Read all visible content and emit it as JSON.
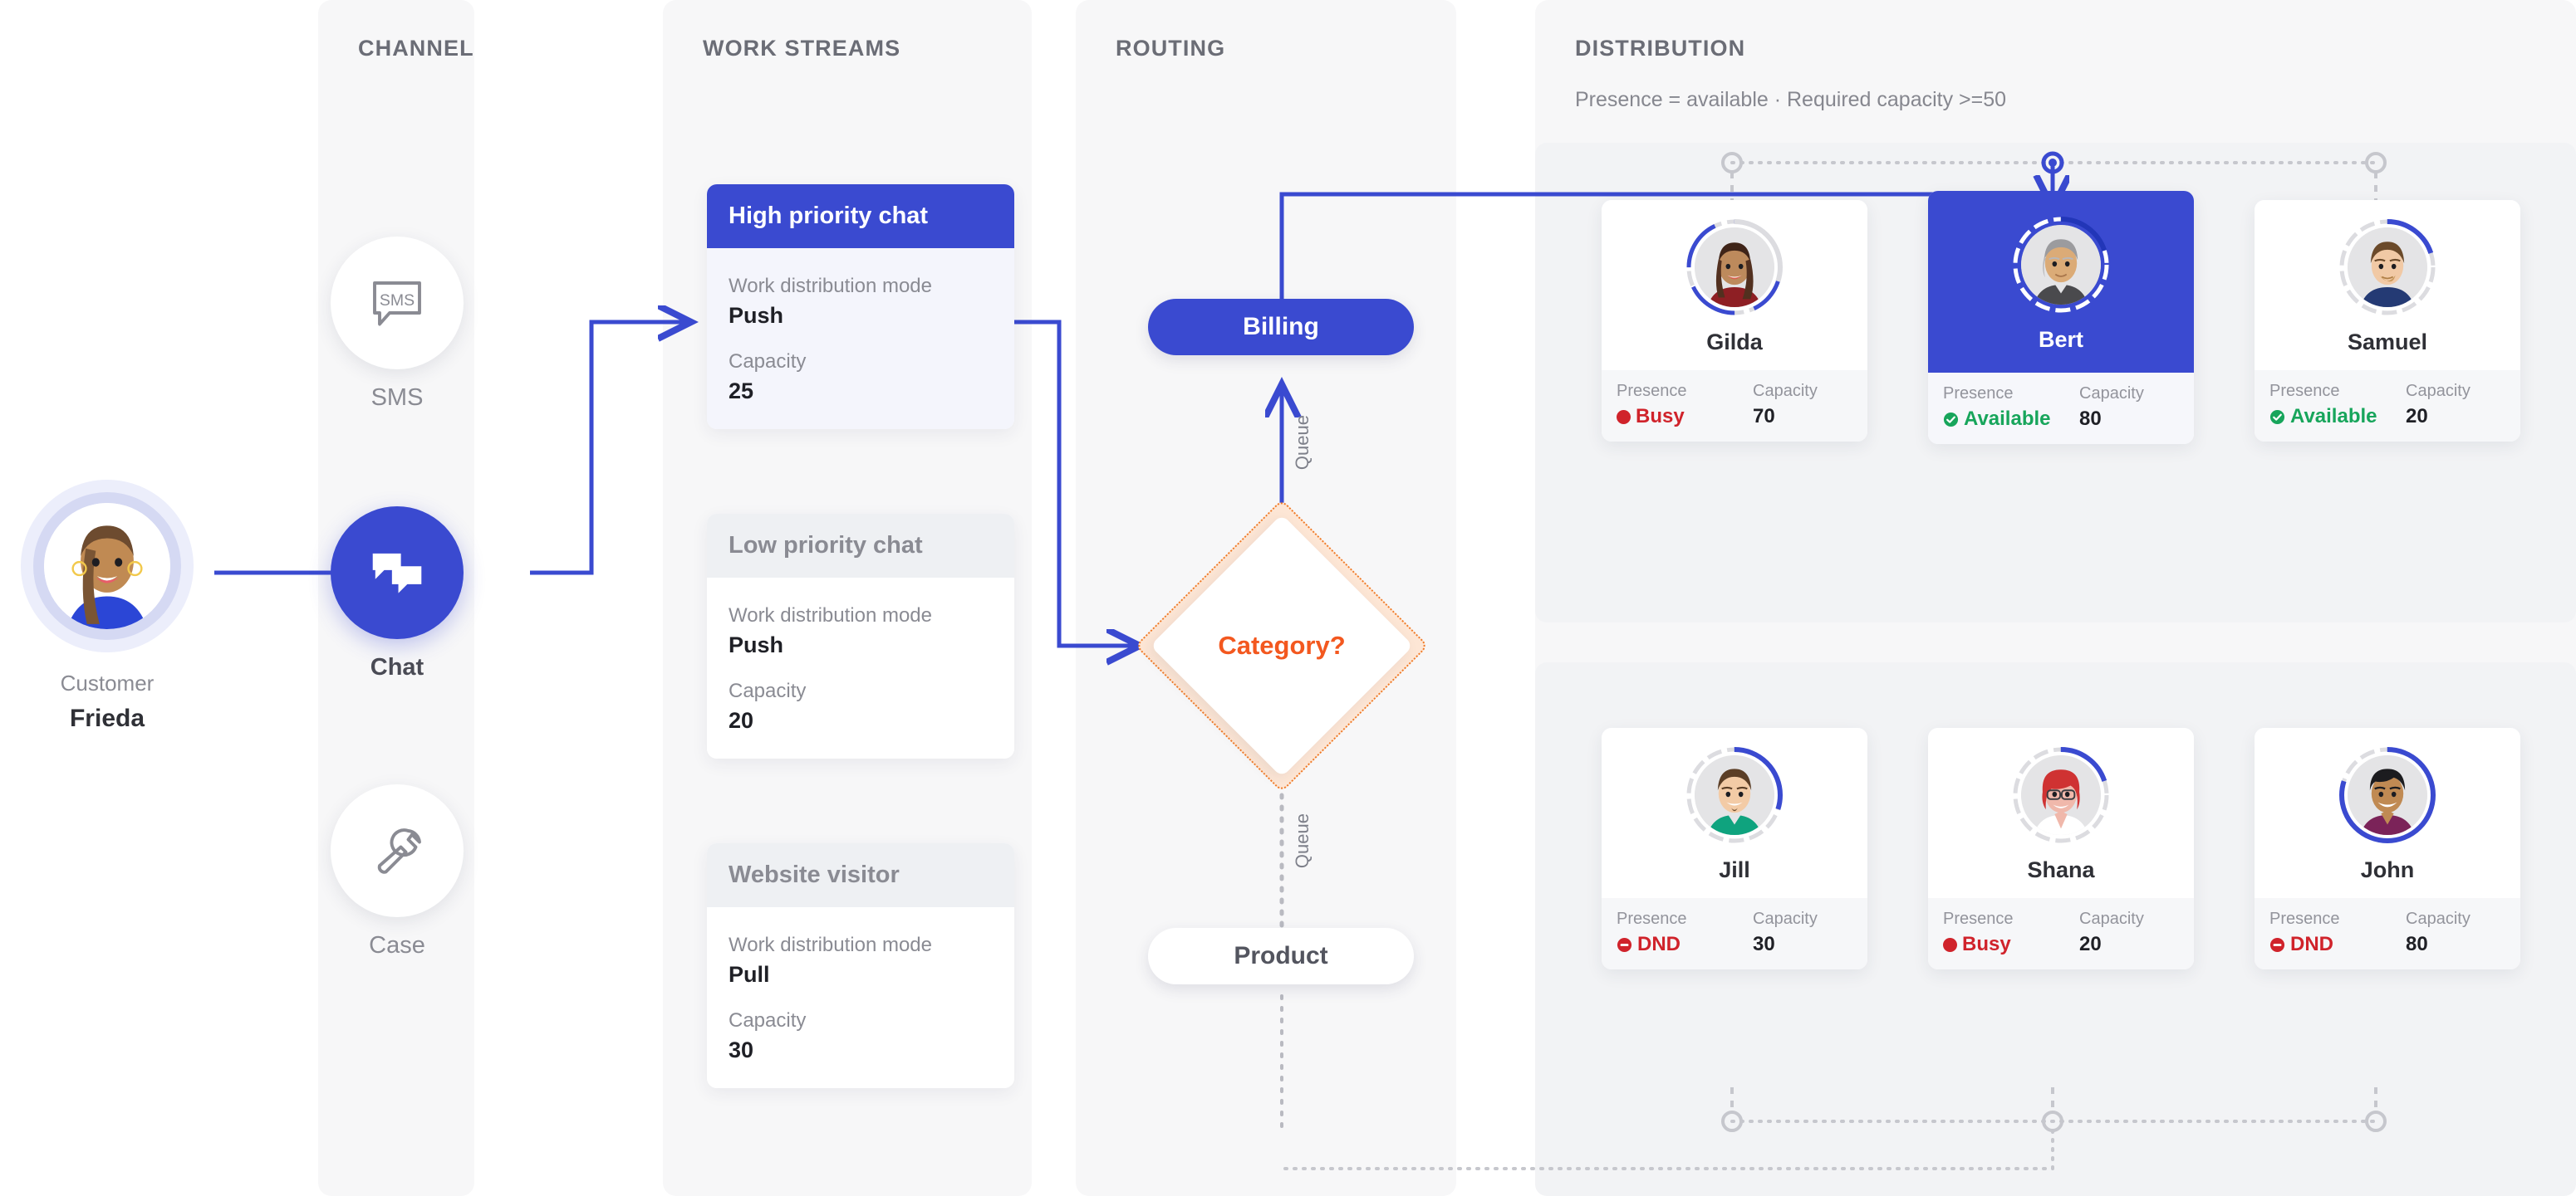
{
  "columns": {
    "channel": {
      "title": "CHANNEL"
    },
    "work_streams": {
      "title": "WORK STREAMS"
    },
    "routing": {
      "title": "ROUTING"
    },
    "distribution": {
      "title": "DISTRIBUTION",
      "filter": "Presence = available  ·  Required capacity >=50"
    }
  },
  "customer": {
    "role_label": "Customer",
    "name": "Frieda",
    "avatar": "customer-avatar"
  },
  "channels": [
    {
      "label": "SMS",
      "icon": "sms-icon",
      "active": false
    },
    {
      "label": "Chat",
      "icon": "chat-icon",
      "active": true
    },
    {
      "label": "Case",
      "icon": "wrench-icon",
      "active": false
    }
  ],
  "work_streams": [
    {
      "name": "High priority chat",
      "mode_label": "Work distribution mode",
      "mode_value": "Push",
      "capacity_label": "Capacity",
      "capacity_value": "25",
      "selected": true
    },
    {
      "name": "Low priority chat",
      "mode_label": "Work distribution mode",
      "mode_value": "Push",
      "capacity_label": "Capacity",
      "capacity_value": "20",
      "selected": false
    },
    {
      "name": "Website visitor",
      "mode_label": "Work distribution mode",
      "mode_value": "Pull",
      "capacity_label": "Capacity",
      "capacity_value": "30",
      "selected": false
    }
  ],
  "routing": {
    "queue_top_label": "Queue",
    "queue_bottom_label": "Queue",
    "decision": "Category?",
    "billing": "Billing",
    "product": "Product"
  },
  "agents": {
    "presence_label": "Presence",
    "capacity_label": "Capacity",
    "group_top": [
      {
        "name": "Gilda",
        "presence": "Busy",
        "presence_state": "busy",
        "capacity": "70",
        "ring_pct": 70,
        "selected": false,
        "avatar": "gilda-avatar"
      },
      {
        "name": "Bert",
        "presence": "Available",
        "presence_state": "avail",
        "capacity": "80",
        "ring_pct": 80,
        "selected": true,
        "avatar": "bert-avatar"
      },
      {
        "name": "Samuel",
        "presence": "Available",
        "presence_state": "avail",
        "capacity": "20",
        "ring_pct": 20,
        "selected": false,
        "avatar": "samuel-avatar"
      }
    ],
    "group_bottom": [
      {
        "name": "Jill",
        "presence": "DND",
        "presence_state": "dnd",
        "capacity": "30",
        "ring_pct": 30,
        "selected": false,
        "avatar": "jill-avatar"
      },
      {
        "name": "Shana",
        "presence": "Busy",
        "presence_state": "busy",
        "capacity": "20",
        "ring_pct": 20,
        "selected": false,
        "avatar": "shana-avatar"
      },
      {
        "name": "John",
        "presence": "DND",
        "presence_state": "dnd",
        "capacity": "80",
        "ring_pct": 80,
        "selected": false,
        "avatar": "john-avatar"
      }
    ]
  },
  "colors": {
    "accent_blue": "#3a4ad0",
    "panel_bg": "#f7f7f8",
    "busy_red": "#d0232b",
    "available_green": "#17a55b",
    "decision_orange": "#f3581f",
    "decision_fill": "#fde6d5"
  }
}
